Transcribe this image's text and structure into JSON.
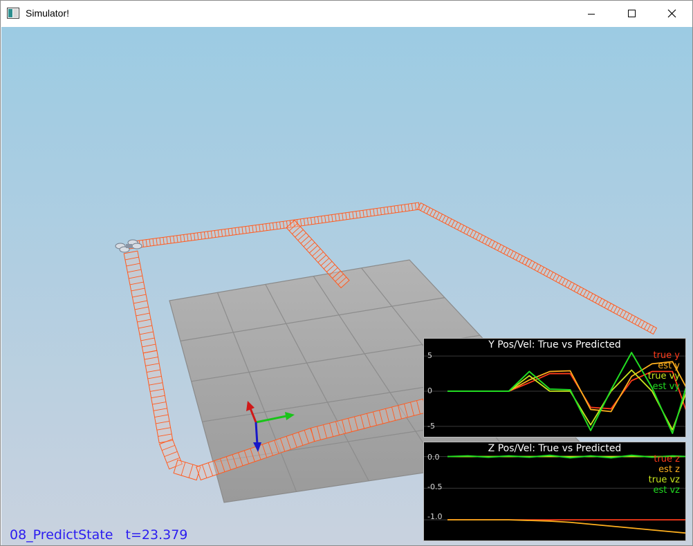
{
  "window": {
    "title": "Simulator!",
    "icon": "app-window-icon",
    "buttons": {
      "minimize": "minimize-icon",
      "maximize": "maximize-icon",
      "close": "close-icon"
    }
  },
  "scene": {
    "sky_top_color": "#9ccbe3",
    "sky_bottom_color": "#c9d2df",
    "floor_color": "#a3a3a3",
    "floor_line_color": "#8a8a8a",
    "trajectory_color": "#ff5a1f",
    "axis_colors": {
      "x": "#19c419",
      "y": "#d01818",
      "z": "#1818c8"
    }
  },
  "status": {
    "scenario": "08_PredictState",
    "time_label": "t=23.379",
    "color": "#2b1cf0"
  },
  "plot_y": {
    "title": "Y Pos/Vel: True vs Predicted",
    "legend": [
      {
        "label": "true y",
        "color": "#ff3a1a"
      },
      {
        "label": "est y",
        "color": "#ffb01e"
      },
      {
        "label": "true vy",
        "color": "#c8e61e"
      },
      {
        "label": "est vy",
        "color": "#22dd22"
      }
    ],
    "ticks": [
      "5",
      "0",
      "-5"
    ]
  },
  "plot_z": {
    "title": "Z Pos/Vel: True vs Predicted",
    "legend": [
      {
        "label": "true z",
        "color": "#ff3a1a"
      },
      {
        "label": "est z",
        "color": "#ffb01e"
      },
      {
        "label": "true vz",
        "color": "#c8e61e"
      },
      {
        "label": "est vz",
        "color": "#22dd22"
      }
    ],
    "ticks": [
      "0.0",
      "-0.5",
      "-1.0"
    ]
  },
  "chart_data": [
    {
      "type": "line",
      "title": "Y Pos/Vel: True vs Predicted",
      "ylim": [
        -6,
        6
      ],
      "grid": true,
      "legend_position": "top-right",
      "x": [
        0,
        2,
        4,
        6,
        8,
        10,
        12,
        14,
        16,
        18,
        20,
        22,
        23.4
      ],
      "series": [
        {
          "name": "true y",
          "values": [
            0,
            0,
            0,
            0,
            1.2,
            2.5,
            2.5,
            -2.3,
            -2.5,
            1.5,
            2.8,
            2.8,
            -3.0
          ]
        },
        {
          "name": "est y",
          "values": [
            0,
            0,
            0,
            0,
            1.6,
            2.8,
            2.9,
            -2.6,
            -2.9,
            2.1,
            3.9,
            4.2,
            0.4
          ]
        },
        {
          "name": "true vy",
          "values": [
            0,
            0,
            0,
            0,
            2.2,
            0,
            0,
            -4.8,
            0,
            3.0,
            0,
            -5.5,
            0
          ]
        },
        {
          "name": "est vy",
          "values": [
            0,
            0,
            0,
            0,
            2.8,
            0.3,
            0.2,
            -5.6,
            0.2,
            5.5,
            0.5,
            -6.0,
            0.9
          ]
        }
      ]
    },
    {
      "type": "line",
      "title": "Z Pos/Vel: True vs Predicted",
      "ylim": [
        -1.25,
        0.05
      ],
      "grid": true,
      "legend_position": "top-right",
      "x": [
        0,
        2,
        4,
        6,
        8,
        10,
        12,
        14,
        16,
        18,
        20,
        22,
        23.4
      ],
      "series": [
        {
          "name": "true z",
          "values": [
            -1.0,
            -1.0,
            -1.0,
            -1.0,
            -1.0,
            -1.0,
            -1.0,
            -1.0,
            -1.0,
            -1.0,
            -1.0,
            -1.0,
            -1.0
          ]
        },
        {
          "name": "est z",
          "values": [
            -1.0,
            -1.0,
            -1.0,
            -1.0,
            -1.01,
            -1.02,
            -1.04,
            -1.07,
            -1.1,
            -1.13,
            -1.16,
            -1.19,
            -1.21
          ]
        },
        {
          "name": "true vz",
          "values": [
            0,
            0,
            0,
            0,
            0,
            0,
            0,
            0,
            0,
            0,
            0,
            0,
            0
          ]
        },
        {
          "name": "est vz",
          "values": [
            0,
            0.01,
            -0.01,
            0.01,
            -0.01,
            0.02,
            -0.02,
            0.01,
            -0.02,
            0.02,
            -0.01,
            0.01,
            0
          ]
        }
      ]
    }
  ]
}
